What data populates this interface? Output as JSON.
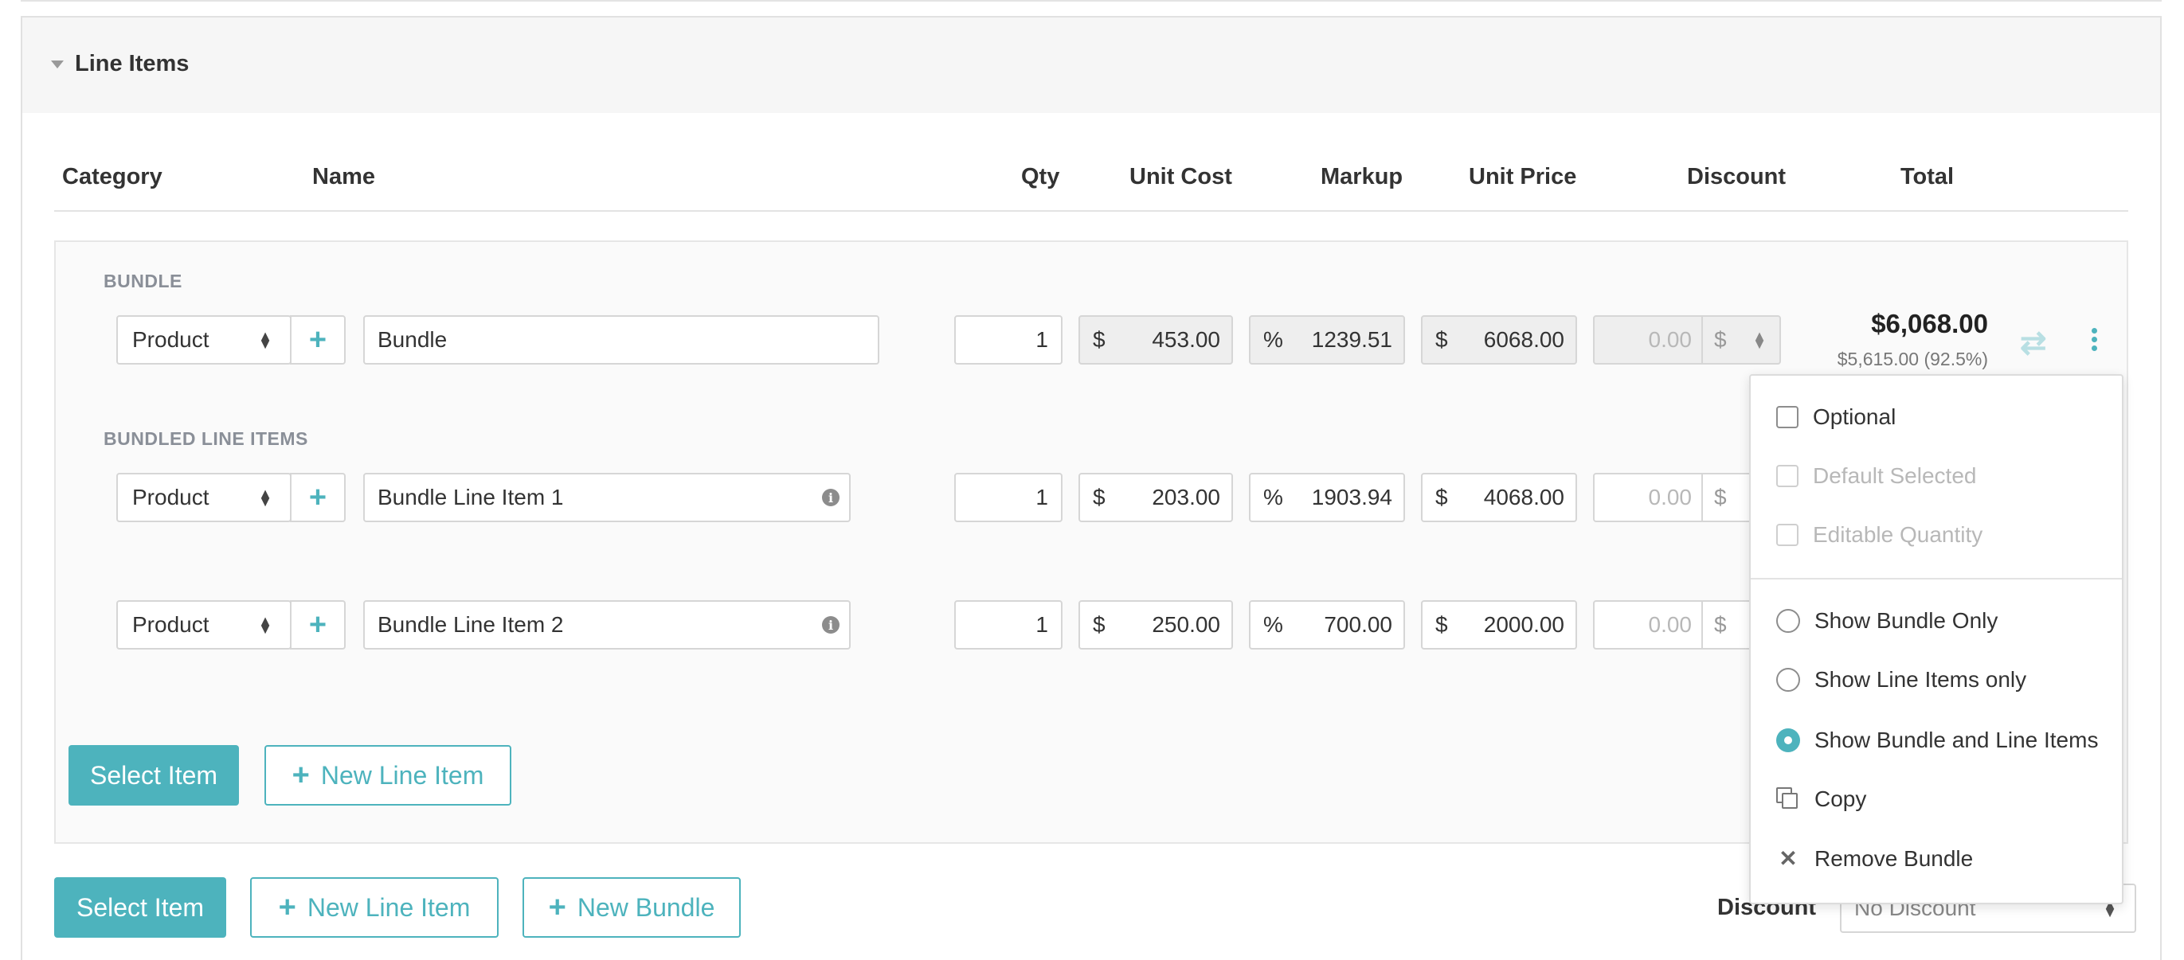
{
  "section": {
    "title": "Line Items"
  },
  "columns": {
    "category": "Category",
    "name": "Name",
    "qty": "Qty",
    "unit_cost": "Unit Cost",
    "markup": "Markup",
    "unit_price": "Unit Price",
    "discount": "Discount",
    "total": "Total"
  },
  "bundle": {
    "label": "BUNDLE",
    "category": "Product",
    "name": "Bundle",
    "qty": "1",
    "cost_prefix": "$",
    "unit_cost": "453.00",
    "markup_prefix": "%",
    "markup": "1239.51",
    "price_prefix": "$",
    "unit_price": "6068.00",
    "discount": "0.00",
    "discount_unit": "$",
    "total": "$6,068.00",
    "profit": "$5,615.00 (92.5%)"
  },
  "bundled_label": "BUNDLED LINE ITEMS",
  "line_items": [
    {
      "category": "Product",
      "name": "Bundle Line Item 1",
      "qty": "1",
      "cost_prefix": "$",
      "unit_cost": "203.00",
      "markup_prefix": "%",
      "markup": "1903.94",
      "price_prefix": "$",
      "unit_price": "4068.00",
      "discount": "0.00",
      "discount_unit": "$"
    },
    {
      "category": "Product",
      "name": "Bundle Line Item 2",
      "qty": "1",
      "cost_prefix": "$",
      "unit_cost": "250.00",
      "markup_prefix": "%",
      "markup": "700.00",
      "price_prefix": "$",
      "unit_price": "2000.00",
      "discount": "0.00",
      "discount_unit": "$"
    }
  ],
  "inner_buttons": {
    "select_item": "Select Item",
    "new_line_item": "New Line Item"
  },
  "bottom": {
    "select_item": "Select Item",
    "new_line_item": "New Line Item",
    "new_bundle": "New Bundle",
    "discount_label": "Discount",
    "discount_value": "No Discount"
  },
  "menu": {
    "optional": "Optional",
    "default_selected": "Default Selected",
    "editable_quantity": "Editable Quantity",
    "show_bundle_only": "Show Bundle Only",
    "show_line_items_only": "Show Line Items only",
    "show_bundle_and_line_items": "Show Bundle and Line Items",
    "copy": "Copy",
    "remove_bundle": "Remove Bundle",
    "selected_display": "Show Bundle and Line Items"
  },
  "colors": {
    "accent": "#4db3bd"
  },
  "icons": [
    "caret-down-icon",
    "sort-arrows-icon",
    "plus-icon",
    "info-icon",
    "repeat-icon",
    "kebab-icon",
    "copy-icon",
    "close-icon"
  ]
}
